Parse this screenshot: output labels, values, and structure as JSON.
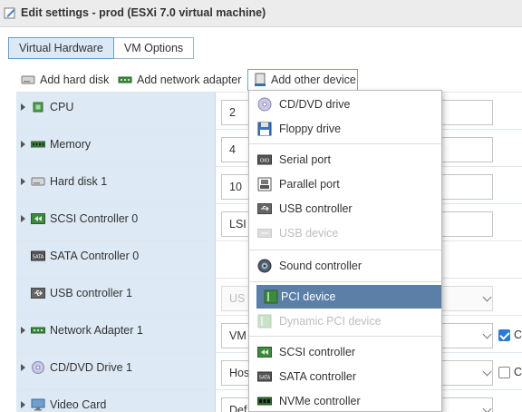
{
  "window": {
    "title": "Edit settings - prod (ESXi 7.0 virtual machine)"
  },
  "tabs": [
    {
      "label": "Virtual Hardware",
      "active": true
    },
    {
      "label": "VM Options",
      "active": false
    }
  ],
  "toolbar": {
    "add_hard_disk": "Add hard disk",
    "add_network_adapter": "Add network adapter",
    "add_other_device": "Add other device"
  },
  "rows": [
    {
      "label": "CPU",
      "icon": "cpu-icon",
      "value": "2"
    },
    {
      "label": "Memory",
      "icon": "memory-icon",
      "value": "4"
    },
    {
      "label": "Hard disk 1",
      "icon": "disk-icon",
      "value": "10"
    },
    {
      "label": "SCSI Controller 0",
      "icon": "scsi-icon",
      "value": "LSI"
    },
    {
      "label": "SATA Controller 0",
      "icon": "sata-icon",
      "value": ""
    },
    {
      "label": "USB controller 1",
      "icon": "usb-icon",
      "value": "US"
    },
    {
      "label": "Network Adapter 1",
      "icon": "network-icon",
      "value": "VM",
      "checkbox_label": "C",
      "checked": true
    },
    {
      "label": "CD/DVD Drive 1",
      "icon": "cdrom-icon",
      "value": "Hos",
      "checkbox_label": "C",
      "checked": false
    },
    {
      "label": "Video Card",
      "icon": "monitor-icon",
      "value": "Def"
    }
  ],
  "menu": {
    "items": [
      {
        "label": "CD/DVD drive",
        "icon": "cd-icon",
        "disabled": false
      },
      {
        "label": "Floppy drive",
        "icon": "floppy-icon",
        "disabled": false
      },
      {
        "label": "Serial port",
        "icon": "serial-port-icon",
        "disabled": false
      },
      {
        "label": "Parallel port",
        "icon": "parallel-port-icon",
        "disabled": false
      },
      {
        "label": "USB controller",
        "icon": "usb-controller-icon",
        "disabled": false
      },
      {
        "label": "USB device",
        "icon": "usb-device-icon",
        "disabled": true
      },
      {
        "label": "Sound controller",
        "icon": "sound-icon",
        "disabled": false
      },
      {
        "label": "PCI device",
        "icon": "pci-icon",
        "disabled": false,
        "selected": true
      },
      {
        "label": "Dynamic PCI device",
        "icon": "dynamic-pci-icon",
        "disabled": true
      },
      {
        "label": "SCSI controller",
        "icon": "scsi-controller-icon",
        "disabled": false
      },
      {
        "label": "SATA controller",
        "icon": "sata-controller-icon",
        "disabled": false
      },
      {
        "label": "NVMe controller",
        "icon": "nvme-controller-icon",
        "disabled": false
      }
    ]
  },
  "colors": {
    "selected_bg": "#5b7fa6",
    "left_panel_bg": "#dde9f4",
    "accent": "#2b7bd3"
  }
}
